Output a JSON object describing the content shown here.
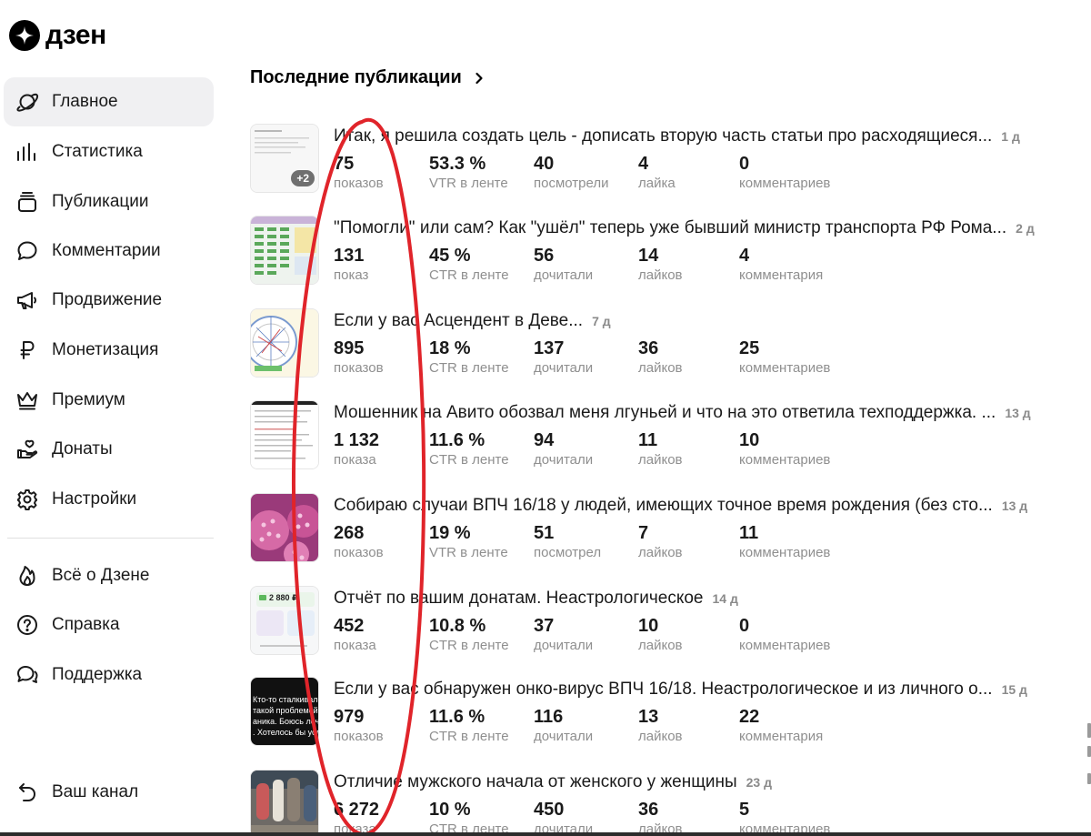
{
  "brand": {
    "logo_text": "дзен"
  },
  "sidebar": {
    "items": [
      {
        "label": "Главное",
        "icon": "planet-icon",
        "active": true
      },
      {
        "label": "Статистика",
        "icon": "bar-chart-icon"
      },
      {
        "label": "Публикации",
        "icon": "stack-icon"
      },
      {
        "label": "Комментарии",
        "icon": "speech-bubble-icon"
      },
      {
        "label": "Продвижение",
        "icon": "megaphone-icon"
      },
      {
        "label": "Монетизация",
        "icon": "ruble-icon"
      },
      {
        "label": "Премиум",
        "icon": "crown-icon"
      },
      {
        "label": "Донаты",
        "icon": "hand-heart-icon"
      },
      {
        "label": "Настройки",
        "icon": "gear-icon"
      }
    ],
    "footer_items": [
      {
        "label": "Всё о Дзене",
        "icon": "flame-icon"
      },
      {
        "label": "Справка",
        "icon": "question-icon"
      },
      {
        "label": "Поддержка",
        "icon": "support-bubble-icon"
      }
    ],
    "channel_link": {
      "label": "Ваш канал",
      "icon": "back-arrow-icon"
    }
  },
  "main": {
    "section_title": "Последние публикации",
    "publications": [
      {
        "title": "Итак, я решила создать цель - дописать вторую часть статьи про расходящиеся...",
        "age": "1 д",
        "thumb_badge": "+2",
        "stats": [
          {
            "value": "75",
            "label": "показов"
          },
          {
            "value": "53.3 %",
            "label": "VTR в ленте"
          },
          {
            "value": "40",
            "label": "посмотрели"
          },
          {
            "value": "4",
            "label": "лайка"
          },
          {
            "value": "0",
            "label": "комментариев"
          }
        ]
      },
      {
        "title": "\"Помогли\" или сам? Как \"ушёл\" теперь уже бывший министр транспорта РФ Рома...",
        "age": "2 д",
        "stats": [
          {
            "value": "131",
            "label": "показ"
          },
          {
            "value": "45 %",
            "label": "CTR в ленте"
          },
          {
            "value": "56",
            "label": "дочитали"
          },
          {
            "value": "14",
            "label": "лайков"
          },
          {
            "value": "4",
            "label": "комментария"
          }
        ]
      },
      {
        "title": "Если у вас Асцендент в Деве...",
        "age": "7 д",
        "stats": [
          {
            "value": "895",
            "label": "показов"
          },
          {
            "value": "18 %",
            "label": "CTR в ленте"
          },
          {
            "value": "137",
            "label": "дочитали"
          },
          {
            "value": "36",
            "label": "лайков"
          },
          {
            "value": "25",
            "label": "комментариев"
          }
        ]
      },
      {
        "title": "Мошенник на Авито обозвал меня лгуньей и что на это ответила техподдержка. ...",
        "age": "13 д",
        "stats": [
          {
            "value": "1 132",
            "label": "показа"
          },
          {
            "value": "11.6 %",
            "label": "CTR в ленте"
          },
          {
            "value": "94",
            "label": "дочитали"
          },
          {
            "value": "11",
            "label": "лайков"
          },
          {
            "value": "10",
            "label": "комментариев"
          }
        ]
      },
      {
        "title": "Собираю случаи ВПЧ 16/18 у людей, имеющих точное время рождения (без сто...",
        "age": "13 д",
        "stats": [
          {
            "value": "268",
            "label": "показов"
          },
          {
            "value": "19 %",
            "label": "VTR в ленте"
          },
          {
            "value": "51",
            "label": "посмотрел"
          },
          {
            "value": "7",
            "label": "лайков"
          },
          {
            "value": "11",
            "label": "комментариев"
          }
        ]
      },
      {
        "title": "Отчёт по вашим донатам. Неастрологическое",
        "age": "14 д",
        "stats": [
          {
            "value": "452",
            "label": "показа"
          },
          {
            "value": "10.8 %",
            "label": "CTR в ленте"
          },
          {
            "value": "37",
            "label": "дочитали"
          },
          {
            "value": "10",
            "label": "лайков"
          },
          {
            "value": "0",
            "label": "комментариев"
          }
        ]
      },
      {
        "title": "Если у вас обнаружен онко-вирус ВПЧ 16/18. Неастрологическое и из личного о...",
        "age": "15 д",
        "stats": [
          {
            "value": "979",
            "label": "показов"
          },
          {
            "value": "11.6 %",
            "label": "CTR в ленте"
          },
          {
            "value": "116",
            "label": "дочитали"
          },
          {
            "value": "13",
            "label": "лайков"
          },
          {
            "value": "22",
            "label": "комментария"
          }
        ]
      },
      {
        "title": "Отличие мужского начала от женского у женщины",
        "age": "23 д",
        "stats": [
          {
            "value": "6 272",
            "label": "показа"
          },
          {
            "value": "10 %",
            "label": "CTR в ленте"
          },
          {
            "value": "450",
            "label": "дочитали"
          },
          {
            "value": "36",
            "label": "лайков"
          },
          {
            "value": "5",
            "label": "комментариев"
          }
        ]
      }
    ]
  },
  "thumbnails": {
    "donation_amount": "2 880 ₽",
    "video_overlay_text": [
      "Кто-то сталкивался",
      "такой проблемой, к",
      "аника. Боюсь лечит",
      ". Хотелось бы услы"
    ]
  },
  "colors": {
    "accent_annotation": "#e0242a",
    "active_bg": "#f0f0f2",
    "muted_text": "#8f8f8f"
  }
}
